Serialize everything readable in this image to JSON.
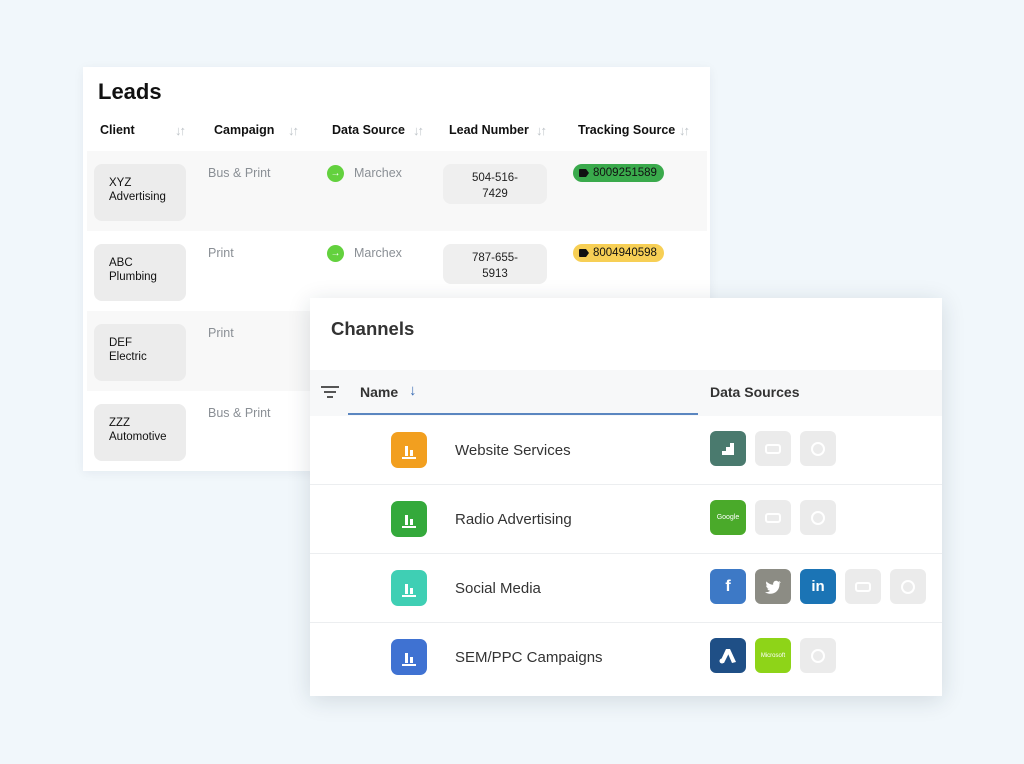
{
  "leads": {
    "title": "Leads",
    "columns": [
      "Client",
      "Campaign",
      "Data Source",
      "Lead Number",
      "Tracking Source"
    ],
    "sort_glyph": "↓↑",
    "rows": [
      {
        "client": [
          "XYZ",
          "Advertising"
        ],
        "campaign": "Bus & Print",
        "data_source": "Marchex",
        "lead_number": [
          "504-516-",
          "7429"
        ],
        "tracking": "8009251589",
        "tracking_color": "#3aaa4c"
      },
      {
        "client": [
          "ABC",
          "Plumbing"
        ],
        "campaign": "Print",
        "data_source": "Marchex",
        "lead_number": [
          "787-655-",
          "5913"
        ],
        "tracking": "8004940598",
        "tracking_color": "#f7cf55"
      },
      {
        "client": [
          "DEF",
          "Electric"
        ],
        "campaign": "Print"
      },
      {
        "client": [
          "ZZZ",
          "Automotive"
        ],
        "campaign": "Bus & Print"
      }
    ]
  },
  "channels": {
    "title": "Channels",
    "name_header": "Name",
    "sort_down_glyph": "↓",
    "data_sources_header": "Data Sources",
    "rows": [
      {
        "name": "Website Services",
        "icon_color": "#f29f1f",
        "sources": [
          {
            "icon": "analytics-icon",
            "color": "#4a7a6e"
          },
          {
            "icon": "generic-source-icon",
            "color": "#ebebeb"
          },
          {
            "icon": "generic-source-icon",
            "color": "#ebebeb"
          }
        ]
      },
      {
        "name": "Radio Advertising",
        "icon_color": "#34a93b",
        "sources": [
          {
            "icon": "google-search-console-icon",
            "color": "#4aaa2a",
            "text": "Google"
          },
          {
            "icon": "generic-source-icon",
            "color": "#ebebeb"
          },
          {
            "icon": "generic-source-icon",
            "color": "#ebebeb"
          }
        ]
      },
      {
        "name": "Social Media",
        "icon_color": "#3fcfb4",
        "sources": [
          {
            "icon": "facebook-icon",
            "color": "#3d79c6",
            "text": "f"
          },
          {
            "icon": "twitter-icon",
            "color": "#8c8c84",
            "text": "🐦"
          },
          {
            "icon": "linkedin-icon",
            "color": "#1b74b5",
            "text": "in"
          },
          {
            "icon": "generic-source-icon",
            "color": "#ebebeb"
          },
          {
            "icon": "generic-source-icon",
            "color": "#ebebeb"
          }
        ]
      },
      {
        "name": "SEM/PPC Campaigns",
        "icon_color": "#3f72d2",
        "sources": [
          {
            "icon": "google-ads-icon",
            "color": "#1f4f86",
            "text": "▲"
          },
          {
            "icon": "microsoft-ads-icon",
            "color": "#8ed418",
            "text": "Microsoft"
          },
          {
            "icon": "generic-source-icon",
            "color": "#ebebeb"
          }
        ]
      }
    ]
  }
}
